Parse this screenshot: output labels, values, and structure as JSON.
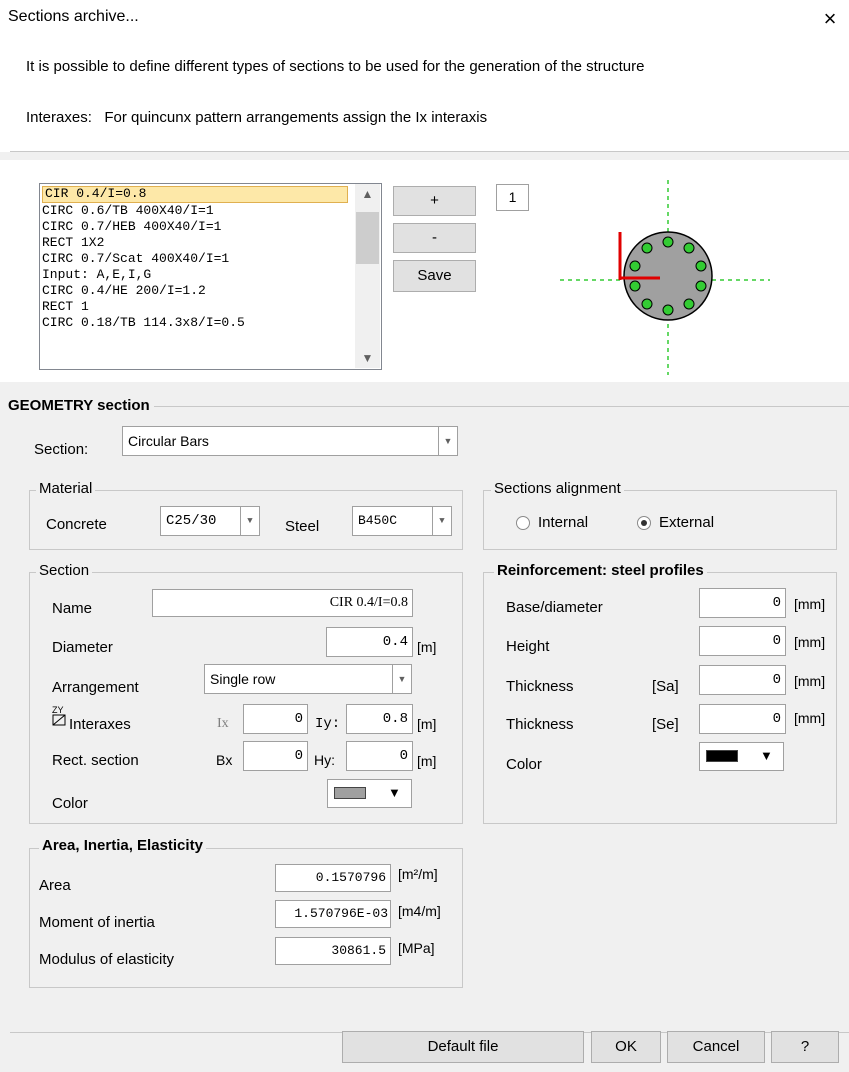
{
  "window": {
    "title": "Sections archive...",
    "close_glyph": "×"
  },
  "description": {
    "line1": "It is possible to define different types of sections to be used for the generation of the structure",
    "line2": "Interaxes:   For quincunx pattern arrangements assign the Ix interaxis"
  },
  "archive": {
    "items": [
      "CIR 0.4/I=0.8",
      "CIRC 0.6/TB 400X40/I=1",
      "CIRC 0.7/HEB 400X40/I=1",
      "RECT 1X2",
      "CIRC 0.7/Scat 400X40/I=1",
      "Input: A,E,I,G",
      "CIRC 0.4/HE 200/I=1.2",
      "RECT 1",
      "CIRC 0.18/TB 114.3x8/I=0.5"
    ],
    "add_label": "+",
    "remove_label": "-",
    "save_label": "Save",
    "count": "1"
  },
  "geometry": {
    "title": "GEOMETRY section",
    "section_label": "Section:",
    "section_value": "Circular Bars"
  },
  "material": {
    "title": "Material",
    "concrete_label": "Concrete",
    "concrete_value": "C25/30",
    "steel_label": "Steel",
    "steel_value": "B450C"
  },
  "alignment": {
    "title": "Sections alignment",
    "internal_label": "Internal",
    "external_label": "External",
    "selected": "External"
  },
  "section": {
    "title": "Section",
    "name_label": "Name",
    "name_value": "CIR 0.4/I=0.8",
    "diameter_label": "Diameter",
    "diameter_value": "0.4",
    "diameter_unit": "[m]",
    "arrangement_label": "Arrangement",
    "arrangement_value": "Single row",
    "interaxes_label": "Interaxes",
    "ix_label": "Ix",
    "ix_value": "0",
    "iy_label": "Iy:",
    "iy_value": "0.8",
    "interaxes_unit": "[m]",
    "rect_label": "Rect. section",
    "bx_label": "Bx",
    "bx_value": "0",
    "hy_label": "Hy:",
    "hy_value": "0",
    "rect_unit": "[m]",
    "color_label": "Color",
    "color_value": "#a0a0a0"
  },
  "reinforcement": {
    "title": "Reinforcement: steel profiles",
    "base_label": "Base/diameter",
    "base_value": "0",
    "base_unit": "[mm]",
    "height_label": "Height",
    "height_value": "0",
    "height_unit": "[mm]",
    "thk_sa_label": "Thickness",
    "thk_sa_tag": "[Sa]",
    "thk_sa_value": "0",
    "thk_sa_unit": "[mm]",
    "thk_se_label": "Thickness",
    "thk_se_tag": "[Se]",
    "thk_se_value": "0",
    "thk_se_unit": "[mm]",
    "color_label": "Color",
    "color_value": "#000000"
  },
  "properties": {
    "title": "Area, Inertia, Elasticity",
    "area_label": "Area",
    "area_value": "0.1570796",
    "area_unit": "[m²/m]",
    "inertia_label": "Moment of inertia",
    "inertia_value": "1.570796E-03",
    "inertia_unit": "[m4/m]",
    "elasticity_label": "Modulus of elasticity",
    "elasticity_value": "30861.5",
    "elasticity_unit": "[MPa]"
  },
  "buttons": {
    "default_file": "Default file",
    "ok": "OK",
    "cancel": "Cancel",
    "help": "?"
  },
  "icons": {
    "close": "close-icon",
    "axes": "axes-icon",
    "dropdown": "chevron-down-icon"
  }
}
